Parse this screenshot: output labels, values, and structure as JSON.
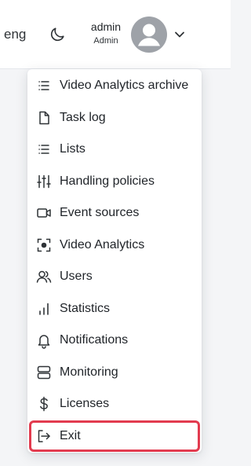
{
  "header": {
    "language": "eng",
    "user_name": "admin",
    "user_role": "Admin"
  },
  "menu": {
    "items": [
      {
        "label": "Video Analytics archive",
        "icon": "list-icon"
      },
      {
        "label": "Task log",
        "icon": "file-icon"
      },
      {
        "label": "Lists",
        "icon": "list-icon"
      },
      {
        "label": "Handling policies",
        "icon": "sliders-icon"
      },
      {
        "label": "Event sources",
        "icon": "video-camera-icon"
      },
      {
        "label": "Video Analytics",
        "icon": "focus-target-icon"
      },
      {
        "label": "Users",
        "icon": "users-icon"
      },
      {
        "label": "Statistics",
        "icon": "bar-chart-icon"
      },
      {
        "label": "Notifications",
        "icon": "bell-icon"
      },
      {
        "label": "Monitoring",
        "icon": "server-icon"
      },
      {
        "label": "Licenses",
        "icon": "dollar-icon"
      },
      {
        "label": "Exit",
        "icon": "log-out-icon",
        "highlighted": true
      }
    ]
  },
  "colors": {
    "highlight_border": "#e23b4f",
    "avatar_fill": "#9ea2a8"
  }
}
